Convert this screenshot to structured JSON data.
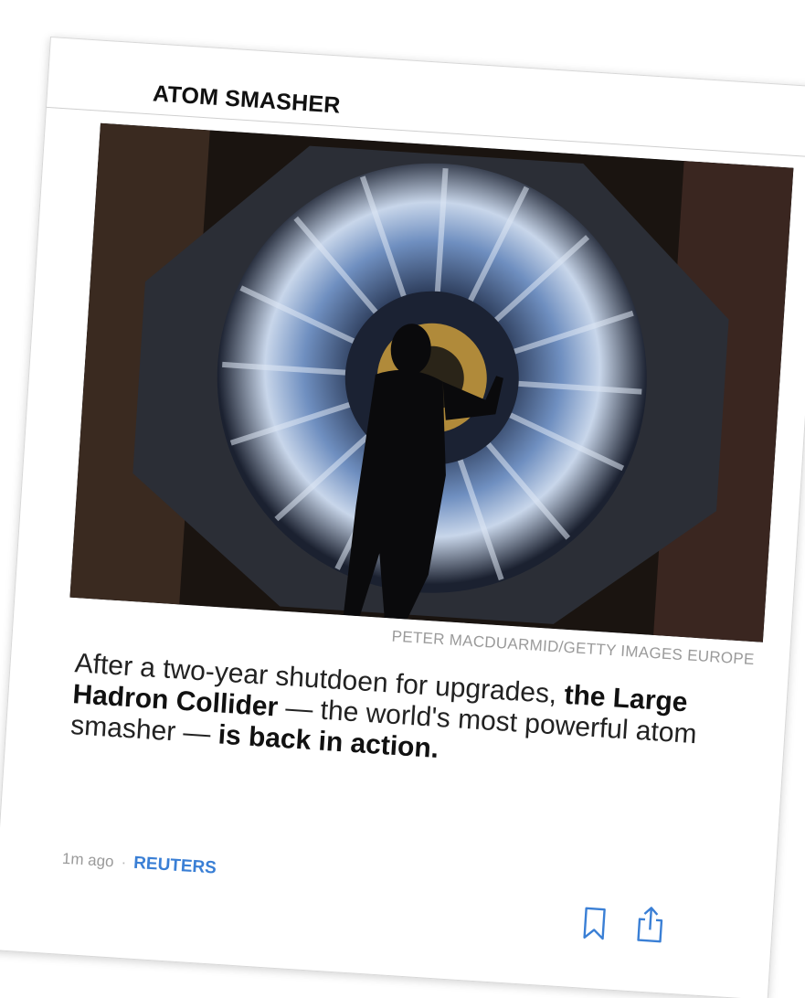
{
  "card": {
    "title": "ATOM SMASHER",
    "photo_credit": "PETER MACDUARMID/GETTY IMAGES EUROPE",
    "summary": {
      "part1": "After a two-year shutdoen for upgrades, ",
      "part2_bold": "the Large Hadron Collider",
      "part3": " — the world's most powerful atom smasher — ",
      "part4_bold": "is back in action."
    },
    "timestamp": "1m ago",
    "separator": "·",
    "source": "REUTERS",
    "icons": {
      "bookmark": "bookmark-icon",
      "share": "share-icon"
    },
    "colors": {
      "accent": "#3a7fd5",
      "credit": "#9a9a9a"
    }
  }
}
